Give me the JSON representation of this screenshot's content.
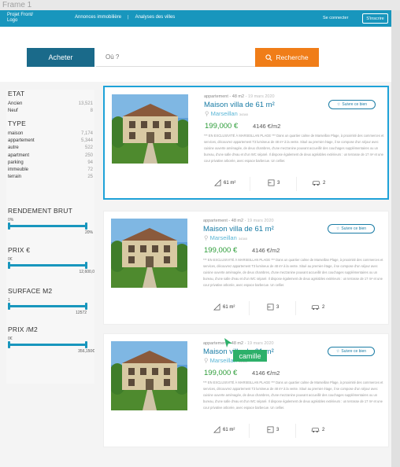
{
  "frame_label": "Frame 1",
  "header": {
    "logo_line1": "Projet Front/",
    "logo_line2": "Logo",
    "nav": [
      "Annonces immobilière",
      "|",
      "Analyses des villes"
    ],
    "login": "Se connecter",
    "signup": "S'inscrire"
  },
  "search": {
    "buy_label": "Acheter",
    "placeholder": "Où ?",
    "search_label": "Recherche"
  },
  "filters": {
    "etat": {
      "title": "ETAT",
      "items": [
        {
          "label": "Ancien",
          "count": "13,521"
        },
        {
          "label": "Neuf",
          "count": "8"
        }
      ]
    },
    "type": {
      "title": "TYPE",
      "items": [
        {
          "label": "maison",
          "count": "7,174"
        },
        {
          "label": "appartement",
          "count": "5,344"
        },
        {
          "label": "autre",
          "count": "522"
        },
        {
          "label": "apartment",
          "count": "250"
        },
        {
          "label": "parking",
          "count": "94"
        },
        {
          "label": "immeuble",
          "count": "72"
        },
        {
          "label": "terrain",
          "count": "25"
        }
      ]
    },
    "rendement": {
      "title": "RENDEMENT BRUT",
      "min": "0%",
      "max": "20%"
    },
    "prix": {
      "title": "PRIX €",
      "min": "0€",
      "max": "12,600,0"
    },
    "surface": {
      "title": "SURFACE M2",
      "min": "1",
      "max": "12572"
    },
    "prix_m2": {
      "title": "PRIX /M2",
      "min": "0€",
      "max": "356,150€"
    }
  },
  "listings": [
    {
      "meta": "appartement - 48 m2 ·",
      "date": "19 mars 2020",
      "title": "Maison villa de 61 m²",
      "city": "Marseillan",
      "zip": "34340",
      "price": "199,000 €",
      "price_m2": "4146 €/m2",
      "description": "*** EN EXCLUSIVITÉ À MARSEILLAN PLAGE *** Dans un quartier calme de Marseillan Plage, à proximité des commerces et services, découvrez appartement T3 lumineux de 48 m² à la vente. Situé au premier étage, il se compose d'un séjour avec cuisine ouverte aménagée, de deux chambres, d'une mezzanine pouvant accueillir des couchages supplémentaires ou un bureau, d'une salle d'eau et d'un WC séparé. Il dispose également de deux agréables extérieurs : un terrasse de 17 m² et une cour privative arborée, avec espace barbecue. Un cellier.",
      "follow": "Suivre ce bien",
      "surface": "61 m²",
      "rooms": "3",
      "parking": "2",
      "selected": true
    },
    {
      "meta": "appartement - 48 m2 ·",
      "date": "19 mars 2020",
      "title": "Maison villa de 61 m²",
      "city": "Marseillan",
      "zip": "34340",
      "price": "199,000 €",
      "price_m2": "4146 €/m2",
      "description": "*** EN EXCLUSIVITÉ À MARSEILLAN PLAGE *** Dans un quartier calme de Marseillan Plage, à proximité des commerces et services, découvrez appartement T3 lumineux de 48 m² à la vente. Situé au premier étage, il se compose d'un séjour avec cuisine ouverte aménagée, de deux chambres, d'une mezzanine pouvant accueillir des couchages supplémentaires ou un bureau, d'une salle d'eau et d'un WC séparé. Il dispose également de deux agréables extérieurs : un terrasse de 17 m² et une cour privative arborée, avec espace barbecue. Un cellier.",
      "follow": "Suivre ce bien",
      "surface": "61 m²",
      "rooms": "3",
      "parking": "2",
      "selected": false
    },
    {
      "meta": "appartement - 48 m2 ·",
      "date": "19 mars 2020",
      "title": "Maison villa de 61 m²",
      "city": "Marseillan",
      "zip": "34340",
      "price": "199,000 €",
      "price_m2": "4146 €/m2",
      "description": "*** EN EXCLUSIVITÉ À MARSEILLAN PLAGE *** Dans un quartier calme de Marseillan Plage, à proximité des commerces et services, découvrez appartement T3 lumineux de 48 m² à la vente. Situé au premier étage, il se compose d'un séjour avec cuisine ouverte aménagée, de deux chambres, d'une mezzanine pouvant accueillir des couchages supplémentaires ou un bureau, d'une salle d'eau et d'un WC séparé. Il dispose également de deux agréables extérieurs : un terrasse de 17 m² et une cour privative arborée, avec espace barbecue. Un cellier.",
      "follow": "Suivre ce bien",
      "surface": "61 m²",
      "rooms": "3",
      "parking": "2",
      "selected": false
    }
  ],
  "cursor_tooltip": "camille",
  "colors": {
    "header": "#1896bd",
    "buy_button": "#1a6a8a",
    "search_button": "#f07d18",
    "price": "#2e9d3a",
    "title": "#1a7ca5",
    "tooltip": "#2db06a"
  }
}
